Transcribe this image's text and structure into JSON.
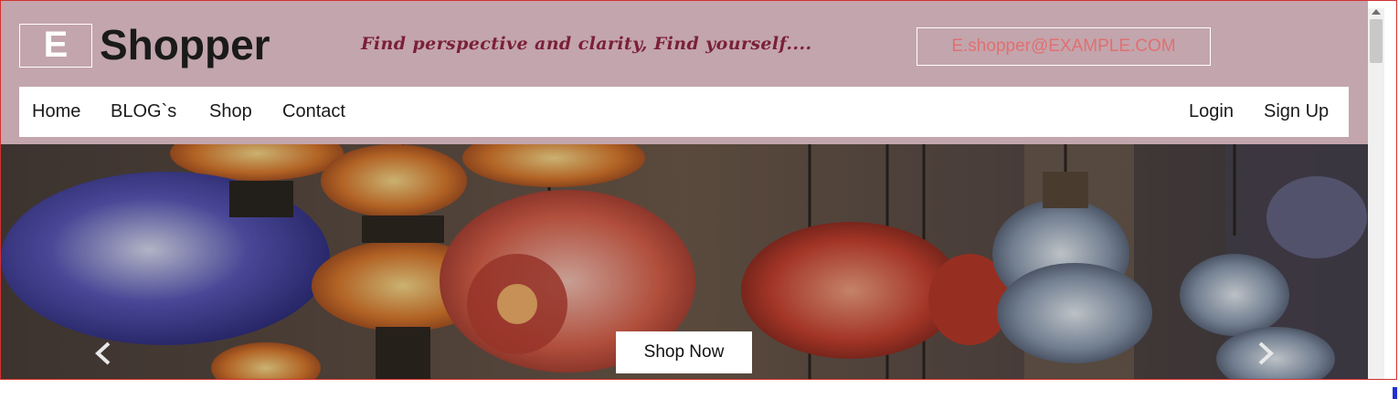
{
  "brand": {
    "logo_letter": "E",
    "name": "Shopper"
  },
  "tagline": "Find perspective and clarity, Find yourself....",
  "contact": {
    "email": "E.shopper@EXAMPLE.COM"
  },
  "nav": {
    "left": [
      "Home",
      "BLOG`s",
      "Shop",
      "Contact"
    ],
    "right": [
      "Login",
      "Sign Up"
    ]
  },
  "hero": {
    "cta_label": "Shop Now"
  },
  "icons": {
    "prev": "chevron-left-icon",
    "next": "chevron-right-icon"
  },
  "colors": {
    "header_bg": "#c3a5ad",
    "tagline": "#7a1f3a",
    "email": "#e07070",
    "frame_border": "#d23030"
  }
}
